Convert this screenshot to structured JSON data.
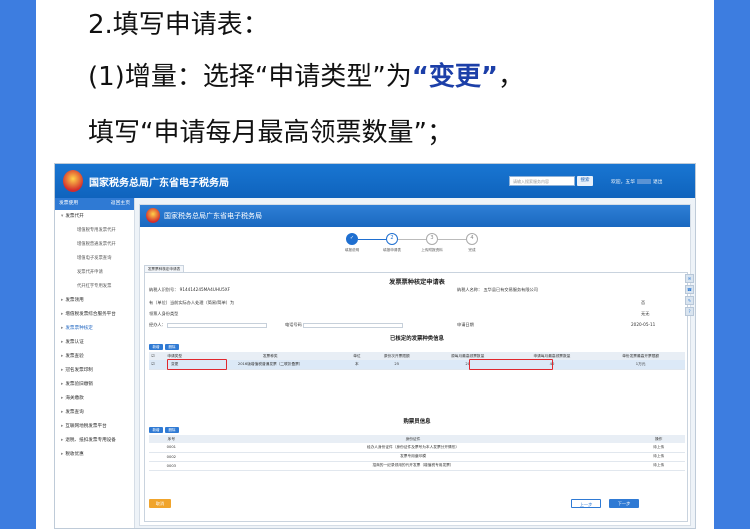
{
  "caption": {
    "line1": "2.填写申请表：",
    "line2_prefix": "(1)增量：选择“申请类型”为",
    "line2_highlight": "“变更”",
    "line2_suffix": "，",
    "line3": "填写“申请每月最高领票数量”；"
  },
  "colors": {
    "accent": "#3d7de0",
    "highlight": "#1c3fa8",
    "red_box": "#e0282e"
  },
  "app": {
    "title": "国家税务总局广东省电子税务局",
    "search_placeholder": "请输入搜索服务内容",
    "search_button": "搜索",
    "user_prefix": "欢迎，五华",
    "user_exit": "退出"
  },
  "sidebar": {
    "header_left": "发票使用",
    "header_right": "返回主页",
    "items": [
      {
        "label": "发票代开",
        "type": "group",
        "caret": "▾"
      },
      {
        "label": "增值税专用发票代开",
        "type": "sub"
      },
      {
        "label": "增值税普通发票代开",
        "type": "sub"
      },
      {
        "label": "增值电子发票查询",
        "type": "sub"
      },
      {
        "label": "发票代开申请",
        "type": "sub"
      },
      {
        "label": "代开红字专用发票",
        "type": "sub"
      },
      {
        "label": "发票领用",
        "type": "group",
        "caret": "▸"
      },
      {
        "label": "增值税发票综合服务平台",
        "type": "group",
        "caret": "▸"
      },
      {
        "label": "发票票种核定",
        "type": "group",
        "caret": "▸",
        "active": true
      },
      {
        "label": "发票认证",
        "type": "group",
        "caret": "▸"
      },
      {
        "label": "发票查验",
        "type": "group",
        "caret": "▸"
      },
      {
        "label": "冠名发票印制",
        "type": "group",
        "caret": "▸"
      },
      {
        "label": "发票验旧缴销",
        "type": "group",
        "caret": "▸"
      },
      {
        "label": "海关缴款",
        "type": "group",
        "caret": "▸"
      },
      {
        "label": "发票查询",
        "type": "group",
        "caret": "▸"
      },
      {
        "label": "互联网地税发票平台",
        "type": "group",
        "caret": "▸"
      },
      {
        "label": "退税、抵扣发票专用设备",
        "type": "group",
        "caret": "▸"
      },
      {
        "label": "税收优惠",
        "type": "group",
        "caret": "▸"
      }
    ]
  },
  "main": {
    "banner_title": "国家税务总局广东省电子税务局",
    "steps": [
      {
        "num": "1",
        "label": "填报说明",
        "state": "done"
      },
      {
        "num": "2",
        "label": "填报申请表",
        "state": "current"
      },
      {
        "num": "3",
        "label": "上传附报资料",
        "state": "todo"
      },
      {
        "num": "4",
        "label": "完成",
        "state": "todo"
      }
    ],
    "form_tab": "发票票种核定申请表",
    "form_title": "发票票种核定申请表",
    "taxpayer_id_label": "纳税人识别号：",
    "taxpayer_id_value": "914414245MA4UHU5XF",
    "taxpayer_name_label": "纳税人名称：",
    "taxpayer_name_value": "五华县已有交易服务有限公司",
    "field_agent_label": "有（单位）当前实际办人处理（简易/简单）为",
    "field_agent_right": "否",
    "field_lead_label": "领票人身份类型",
    "field_lead_right": "无无",
    "handler_label": "经办人：",
    "handler_phone_label": "电话号码",
    "apply_date_label": "申请日期",
    "apply_date_value": "2020-05-11",
    "approved_section": "已核定的发票种类信息",
    "btn_add": "新增",
    "btn_delete": "删除",
    "table_headers": [
      "申请类型",
      "发票种类",
      "单位",
      "原份次开票限额",
      "原每月最高领票数量",
      "申请每月最高领票数量",
      "单份发票最高开票限额"
    ],
    "table_rows": [
      {
        "type": "变更",
        "invoice": "2016版增值税普通发票（二联折叠票）",
        "unit": "本",
        "orig_limit": "25",
        "orig_monthly": "20",
        "new_monthly": "40",
        "max_single": "1万元"
      }
    ],
    "buyer_section": "购票员信息",
    "buyer_headers": [
      "序号",
      "身份证件",
      "操作"
    ],
    "buyer_rows": [
      {
        "no": "0001",
        "desc": "经办人身份证件（身份证件及票号为本人发票分开情形）",
        "op": "待上传"
      },
      {
        "no": "0002",
        "desc": "发票专用章印模",
        "op": "待上传"
      },
      {
        "no": "0003",
        "desc": "招商的一纪录领用的代开发票（增值税专用发票）",
        "op": "待上传"
      }
    ],
    "btn_back": "取消",
    "btn_prev": "上一步",
    "btn_next": "下一步"
  }
}
